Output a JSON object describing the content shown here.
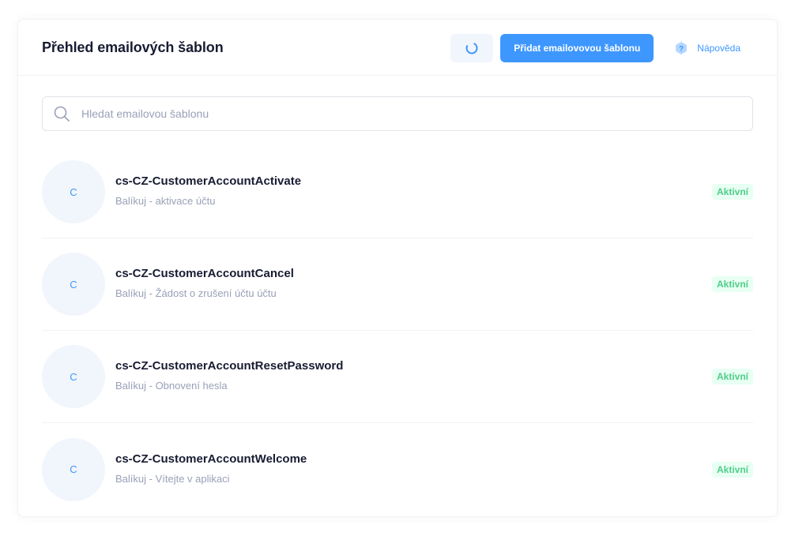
{
  "header": {
    "title": "Přehled emailových šablon",
    "add_label": "Přidat emailovovou šablonu",
    "help_label": "Nápověda"
  },
  "search": {
    "placeholder": "Hledat emailovou šablonu",
    "value": ""
  },
  "icons": {
    "refresh": "refresh-icon",
    "help": "question-icon",
    "search": "search-icon"
  },
  "colors": {
    "accent": "#3e97ff",
    "success": "#50cd89",
    "success_bg": "#e8fff3",
    "muted": "#99a1b7"
  },
  "templates": [
    {
      "initial": "C",
      "name": "cs-CZ-CustomerAccountActivate",
      "description": "Balíkuj - aktivace účtu",
      "status": "Aktivní"
    },
    {
      "initial": "C",
      "name": "cs-CZ-CustomerAccountCancel",
      "description": "Balíkuj - Žádost o zrušení účtu účtu",
      "status": "Aktivní"
    },
    {
      "initial": "C",
      "name": "cs-CZ-CustomerAccountResetPassword",
      "description": "Balíkuj - Obnovení hesla",
      "status": "Aktivní"
    },
    {
      "initial": "C",
      "name": "cs-CZ-CustomerAccountWelcome",
      "description": "Balíkuj - Vítejte v aplikaci",
      "status": "Aktivní"
    }
  ]
}
